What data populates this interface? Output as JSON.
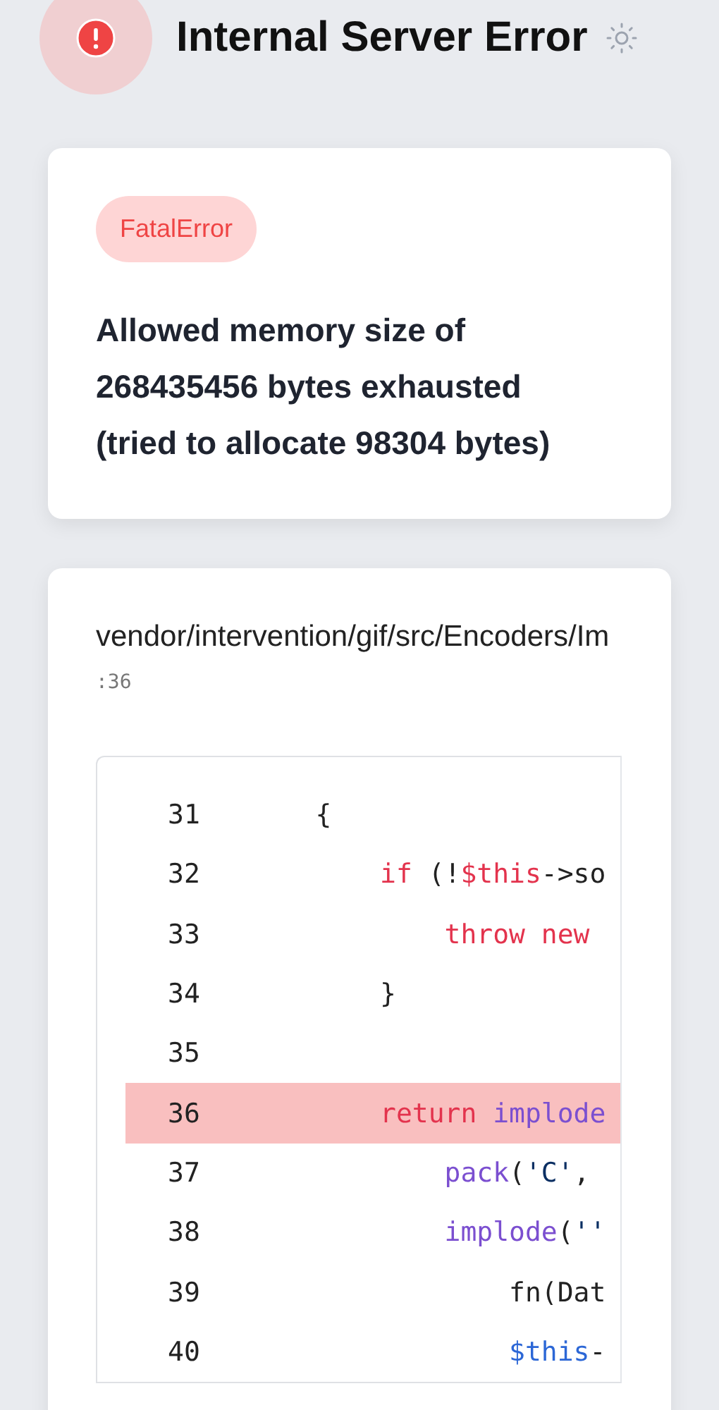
{
  "header": {
    "title": "Internal Server Error"
  },
  "error": {
    "type": "FatalError",
    "message": "Allowed memory size of 268435456 bytes exhausted (tried to allocate 98304 bytes)"
  },
  "frame": {
    "path": "vendor/intervention/gif/src/Encoders/Im",
    "line": ":36",
    "code": [
      {
        "number": "31",
        "selected": false,
        "tokens": [
          {
            "kind": "plain",
            "text": "    {"
          }
        ]
      },
      {
        "number": "32",
        "selected": false,
        "tokens": [
          {
            "kind": "keyword",
            "text": "        if"
          },
          {
            "kind": "plain",
            "text": " (!"
          },
          {
            "kind": "keyword",
            "text": "$this"
          },
          {
            "kind": "plain",
            "text": "->so"
          }
        ]
      },
      {
        "number": "33",
        "selected": false,
        "tokens": [
          {
            "kind": "keyword",
            "text": "            throw new"
          }
        ]
      },
      {
        "number": "34",
        "selected": false,
        "tokens": [
          {
            "kind": "plain",
            "text": "        }"
          }
        ]
      },
      {
        "number": "35",
        "selected": false
      },
      {
        "number": "36",
        "selected": true,
        "tokens": [
          {
            "kind": "keyword",
            "text": "        return"
          },
          {
            "kind": "call",
            "text": " implode"
          }
        ]
      },
      {
        "number": "37",
        "selected": false,
        "tokens": [
          {
            "kind": "call",
            "text": "            pack"
          },
          {
            "kind": "plain",
            "text": "("
          },
          {
            "kind": "string",
            "text": "'C'"
          },
          {
            "kind": "plain",
            "text": ","
          }
        ]
      },
      {
        "number": "38",
        "selected": false,
        "tokens": [
          {
            "kind": "call",
            "text": "            implode"
          },
          {
            "kind": "plain",
            "text": "("
          },
          {
            "kind": "string",
            "text": "''"
          }
        ]
      },
      {
        "number": "39",
        "selected": false,
        "tokens": [
          {
            "kind": "plain",
            "text": "                fn(Dat"
          }
        ]
      },
      {
        "number": "40",
        "selected": false,
        "tokens": [
          {
            "kind": "variable",
            "text": "                $this"
          },
          {
            "kind": "plain",
            "text": "-"
          }
        ]
      }
    ]
  }
}
